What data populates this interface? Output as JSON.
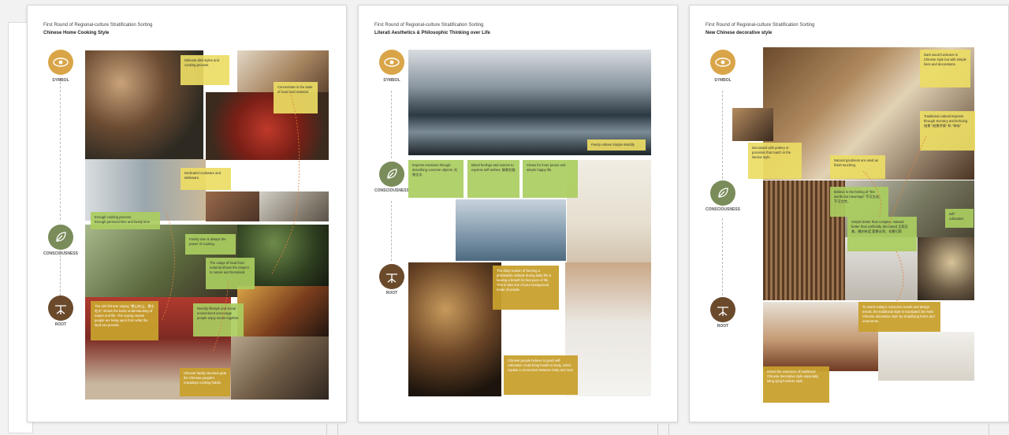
{
  "colors": {
    "symbol": "#d9a548",
    "consciousness": "#7a8c5a",
    "root": "#6b4a2c",
    "yellow_note": "#ebdc64",
    "green_note": "#aacd5f",
    "gold_note": "#c8a02d"
  },
  "levels": {
    "symbol": "SYMBOL",
    "consciousness": "CONSCIOUSNESS",
    "root": "ROOT"
  },
  "pages": [
    {
      "title": "First Round of Regional-culture Stratification Sorting",
      "subtitle": "Chinese Home Cooking Style",
      "notes": [
        "Delicate dish styles and cooking process.",
        "Concentrate in the taste of local food material.",
        "Dedicated cookware and tableware.",
        "Enough cooking process.\nEnough personal time and family time",
        "Family time is always the power of cooking.",
        "The usage of local food material shows the respect to nature and homeland.",
        "The old Chinese saying \"靠山吃山，靠水吃水\" shows the basic understanding of nature and life. The saying means people are living upon from what the land can provide.",
        "Worldly lifestyle and social environment encourage people enjoy meals together.",
        "Chinese family structure gets the Chinese people's nowadays cooking habits."
      ]
    },
    {
      "title": "First Round of Regional-culture Stratification Sorting",
      "subtitle": "Literati Aesthetics & Philosophic Thinking over Life",
      "notes": [
        "Poetry  Artless  Simple  Worldly",
        "Express emotions through describing concrete objects. 托物言志",
        "Blend feelings and scenes to express self wishes. 情景交融",
        "Chase for inner peace and simple happy life.",
        "The deep reason of forming a philosophic attitude during daily life is leaving a breath for fast pace of life. This is also one of your background mode of people.",
        "Chinese people believe in good self-cultivation could bring health to body, which explain a connection between body and soul."
      ]
    },
    {
      "title": "First Round of Regional-culture Stratification Sorting",
      "subtitle": "New Chinese decorative style",
      "notes": [
        "Dark wood furnitures in Chinese style but with simple lines and decorations.",
        "Traditional cultural Express through Scenery and Echoing 借景 \"借景抒情\" 和 \"神似\"",
        "Decorated with pottery or porcelain that match in the interior style.",
        "Natural goodness are used as finish touching.",
        "Believe in the feeling of \"the words but meanings\" 不可言说，不可言传。",
        "self-cultivation",
        "Simple better than complex. Natural better than artificially decorated 至简至美，雕刻有度 要繁去简，化繁归简",
        "To match today's consumer needs and design trends, the traditional style is translated into New Chinese decorative style by simplifying forms and ornaments.",
        "Inherit the essences of traditional Chinese decorative style especially Ming Qing furniture style."
      ]
    }
  ]
}
